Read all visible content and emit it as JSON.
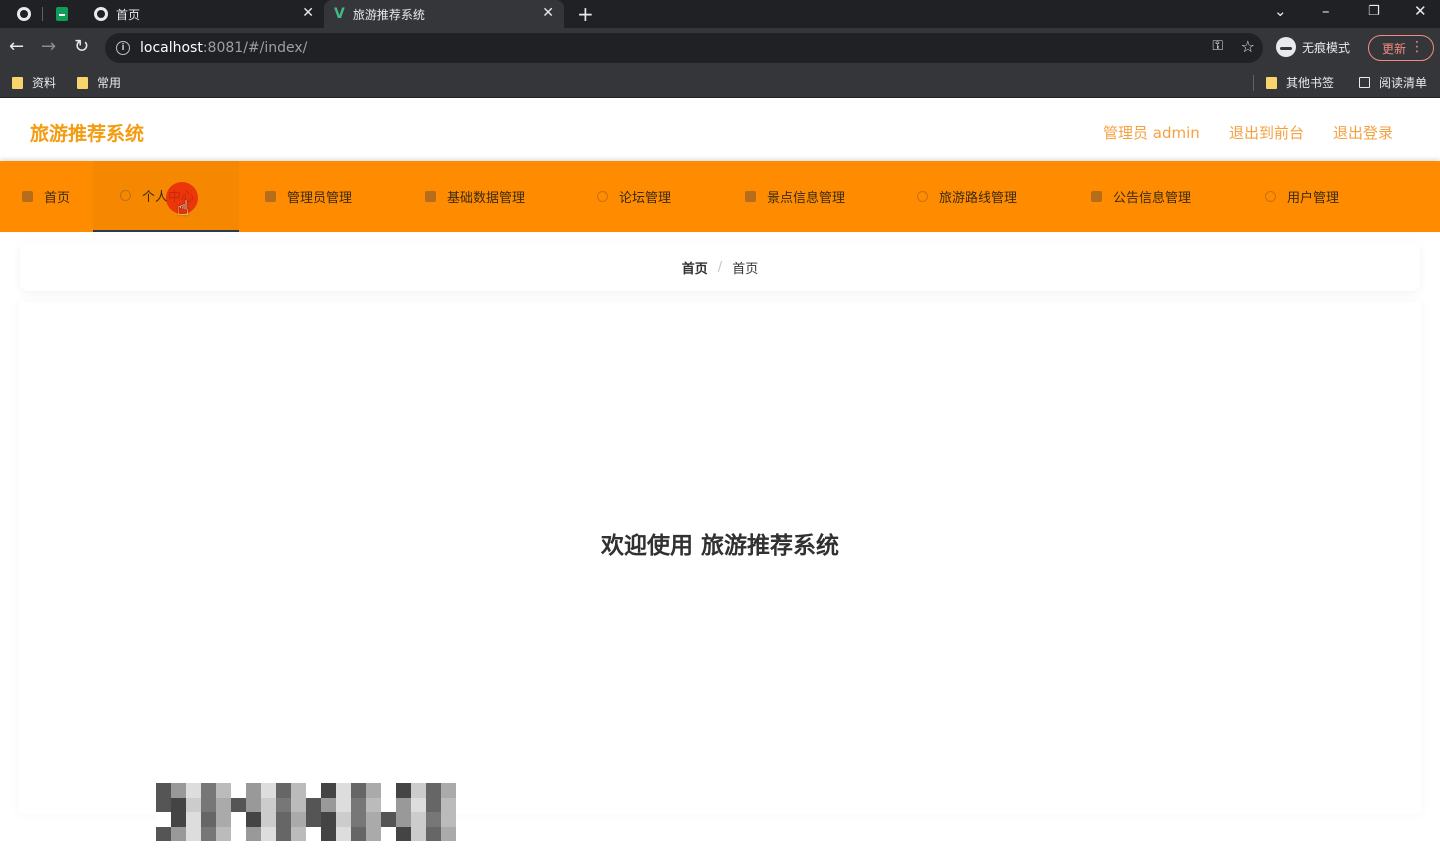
{
  "browser": {
    "tabs": [
      {
        "title": "首页",
        "active": false
      },
      {
        "title": "旅游推荐系统",
        "active": true
      }
    ],
    "url": {
      "host": "localhost",
      "path": ":8081/#/index/"
    },
    "incognito_label": "无痕模式",
    "update_label": "更新",
    "bookmarks": [
      "资料",
      "常用"
    ],
    "other_bookmarks": "其他书签",
    "reading_list": "阅读清单"
  },
  "header": {
    "title": "旅游推荐系统",
    "user_label": "管理员 admin",
    "front_link": "退出到前台",
    "logout_link": "退出登录"
  },
  "nav": [
    {
      "label": "首页",
      "icon": "home-icon"
    },
    {
      "label": "个人中心",
      "icon": "user-icon",
      "active": true
    },
    {
      "label": "管理员管理",
      "icon": "shield-icon"
    },
    {
      "label": "基础数据管理",
      "icon": "folder-icon"
    },
    {
      "label": "论坛管理",
      "icon": "forum-icon"
    },
    {
      "label": "景点信息管理",
      "icon": "grid-icon"
    },
    {
      "label": "旅游路线管理",
      "icon": "route-icon"
    },
    {
      "label": "公告信息管理",
      "icon": "notice-icon"
    },
    {
      "label": "用户管理",
      "icon": "users-icon"
    }
  ],
  "breadcrumb": [
    "首页",
    "首页"
  ],
  "welcome_text": "欢迎使用 旅游推荐系统",
  "colors": {
    "accent": "#ff8c00",
    "title": "#f39c12",
    "link": "#f5a142"
  }
}
